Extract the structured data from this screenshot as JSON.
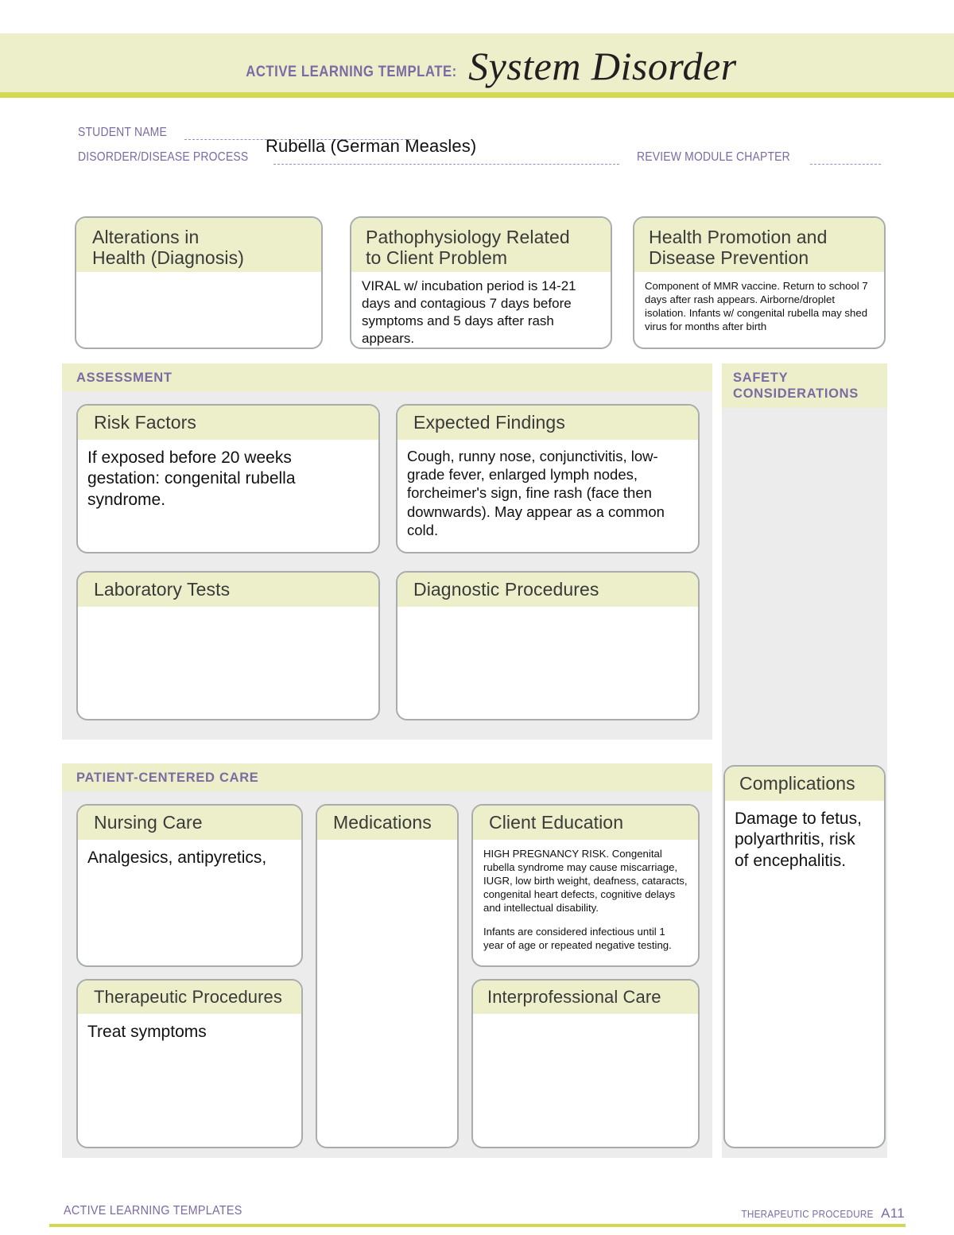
{
  "header": {
    "eyebrow": "ACTIVE LEARNING TEMPLATE:",
    "title": "System Disorder"
  },
  "form": {
    "student_name_label": "STUDENT NAME",
    "disorder_label": "DISORDER/DISEASE PROCESS",
    "disorder_value": "Rubella (German Measles)",
    "review_module_label": "REVIEW MODULE CHAPTER"
  },
  "top_boxes": [
    {
      "title": "Alterations in\nHealth (Diagnosis)",
      "body": ""
    },
    {
      "title": "Pathophysiology Related\nto Client Problem",
      "body": "VIRAL w/ incubation period is 14-21 days and contagious 7 days before symptoms and 5 days after rash appears."
    },
    {
      "title": "Health Promotion and\nDisease Prevention",
      "body": "Component of MMR vaccine. Return to school 7 days after rash appears. Airborne/droplet isolation. Infants w/ congenital rubella may shed virus for months after birth"
    }
  ],
  "assessment": {
    "section_title": "ASSESSMENT",
    "risk_factors": {
      "title": "Risk Factors",
      "body": "If exposed before 20 weeks gestation: congenital rubella syndrome."
    },
    "expected_findings": {
      "title": "Expected Findings",
      "body": "Cough, runny nose, conjunctivitis, low-grade fever, enlarged lymph nodes, forcheimer's sign, fine rash (face then downwards). May appear as a common cold."
    },
    "laboratory_tests": {
      "title": "Laboratory Tests",
      "body": ""
    },
    "diagnostic_procedures": {
      "title": "Diagnostic Procedures",
      "body": ""
    }
  },
  "safety": {
    "section_title": "SAFETY\nCONSIDERATIONS",
    "body": ""
  },
  "patient_care": {
    "section_title": "PATIENT-CENTERED CARE",
    "nursing_care": {
      "title": "Nursing Care",
      "body": "Analgesics, antipyretics,"
    },
    "medications": {
      "title": "Medications",
      "body": ""
    },
    "client_education": {
      "title": "Client Education",
      "body_1": "HIGH PREGNANCY RISK. Congenital rubella syndrome may cause miscarriage, IUGR, low birth weight, deafness, cataracts, congenital heart defects, cognitive delays and intellectual disability.",
      "body_2": "Infants are considered infectious until 1 year of age or repeated negative testing."
    },
    "therapeutic_procedures": {
      "title": "Therapeutic Procedures",
      "body": "Treat symptoms"
    },
    "interprofessional_care": {
      "title": "Interprofessional Care",
      "body": ""
    }
  },
  "complications": {
    "title": "Complications",
    "body": "Damage to fetus, polyarthritis, risk of encephalitis."
  },
  "footer": {
    "left": "ACTIVE LEARNING TEMPLATES",
    "right_label": "THERAPEUTIC PROCEDURE",
    "page": "A11"
  },
  "colors": {
    "band": "#edefcb",
    "rule": "#d2d84f",
    "accent_text": "#7b6aa3",
    "panel_bg": "#ececec",
    "card_border": "#a9acac"
  }
}
